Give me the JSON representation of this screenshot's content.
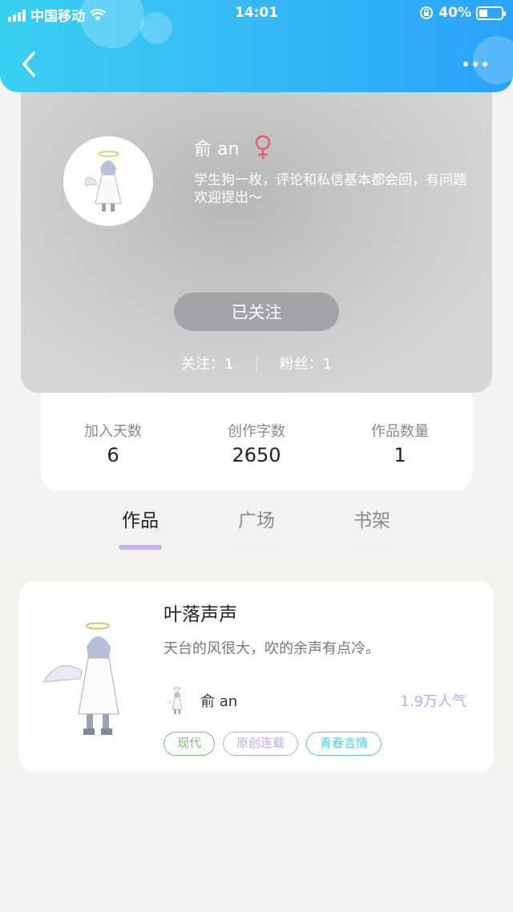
{
  "status_bar": {
    "carrier": "中国移动",
    "time": "14:01",
    "battery": "40%",
    "battery_level": 0.4
  },
  "profile": {
    "name": "俞 an",
    "gender_symbol": "♀",
    "bio": "学生狗一枚，评论和私信基本都会回，有问题欢迎提出～",
    "follow_button": "已关注",
    "following": "关注：1",
    "followers": "粉丝：1"
  },
  "stats": [
    {
      "label": "加入天数",
      "value": "6"
    },
    {
      "label": "创作字数",
      "value": "2650"
    },
    {
      "label": "作品数量",
      "value": "1"
    }
  ],
  "tabs": [
    {
      "label": "作品",
      "active": true
    },
    {
      "label": "广场",
      "active": false
    },
    {
      "label": "书架",
      "active": false
    }
  ],
  "work": {
    "title": "叶落声声",
    "description": "天台的风很大，吹的余声有点冷。",
    "author": "俞 an",
    "popularity": "1.9万人气",
    "tags": [
      {
        "label": "现代",
        "color": "#7cbf7a"
      },
      {
        "label": "原创连载",
        "color": "#c6a9ea"
      },
      {
        "label": "青春言情",
        "color": "#5ac8e0"
      }
    ]
  },
  "colors": {
    "header_start": "#39d0f2",
    "header_end": "#2aa3fb",
    "accent": "#c9b1ef",
    "gender": "#e0607a"
  }
}
